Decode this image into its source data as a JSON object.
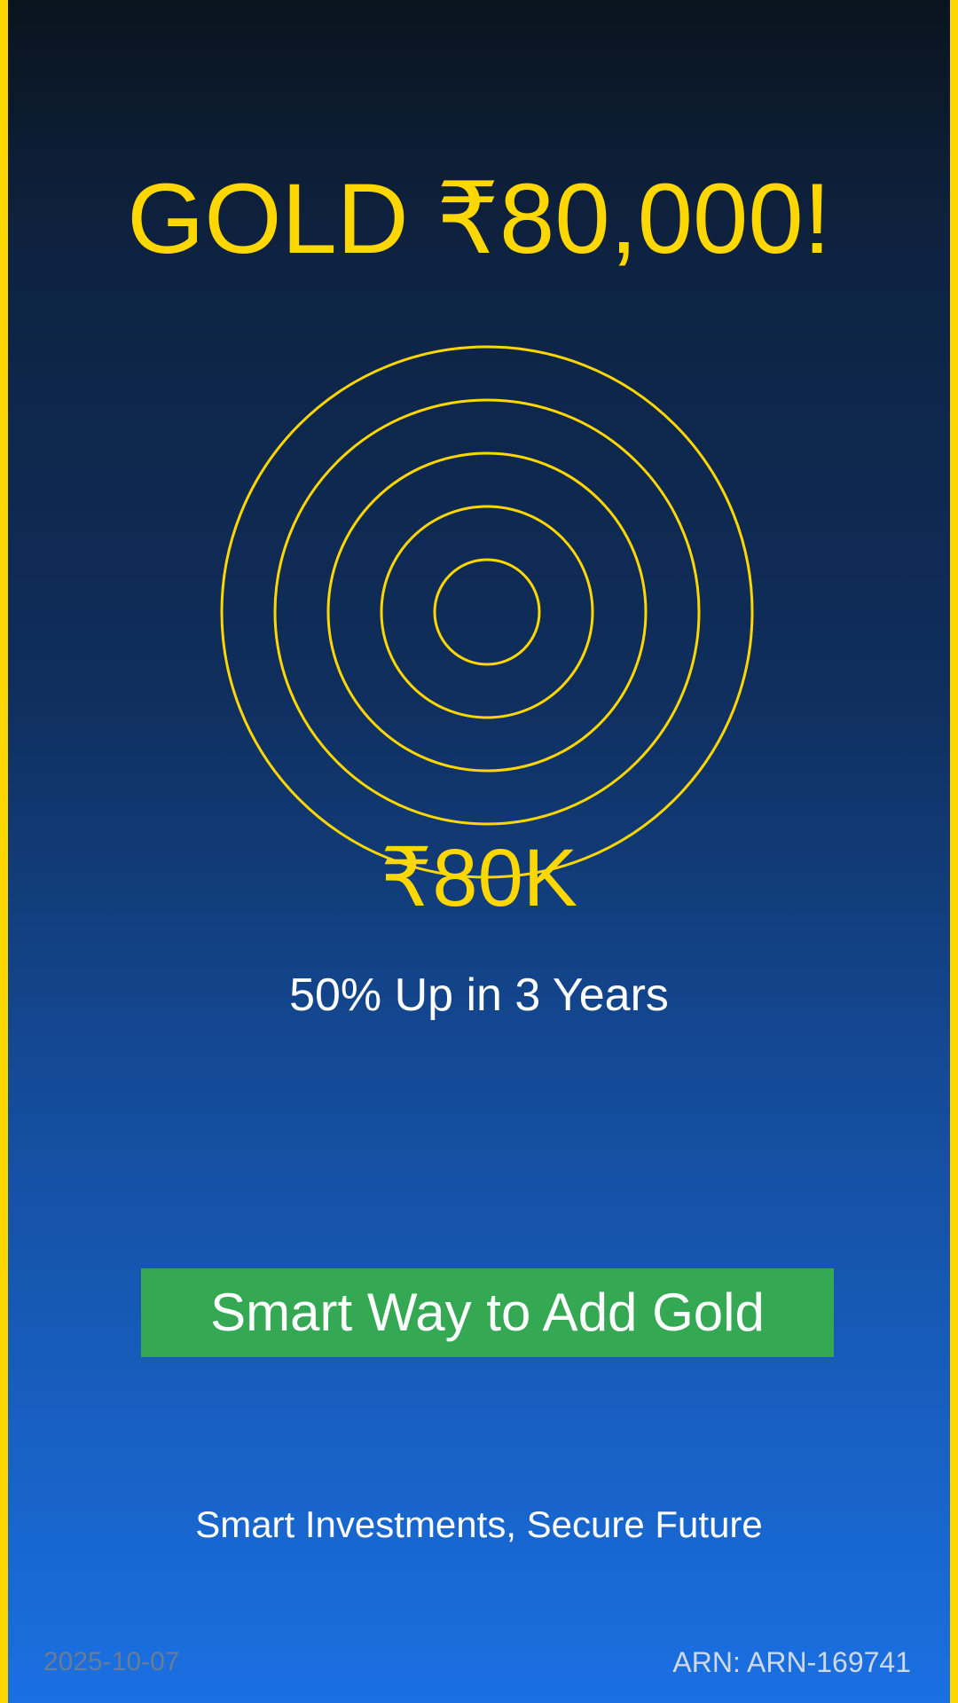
{
  "headline": "GOLD ₹80,000!",
  "highlight": {
    "value": "₹80K",
    "caption": "50% Up in 3 Years"
  },
  "cta": {
    "label": "Smart Way to Add Gold"
  },
  "tagline": "Smart Investments, Secure Future",
  "footer": {
    "date": "2025-10-07",
    "arn": "ARN: ARN-169741"
  },
  "colors": {
    "accent": "#ffd700",
    "cta_bg": "#34a853",
    "bg_top": "#0a141e",
    "bg_bottom": "#1a70e2"
  },
  "decoration": {
    "icon": "concentric-rings-icon",
    "ring_count": 5
  }
}
